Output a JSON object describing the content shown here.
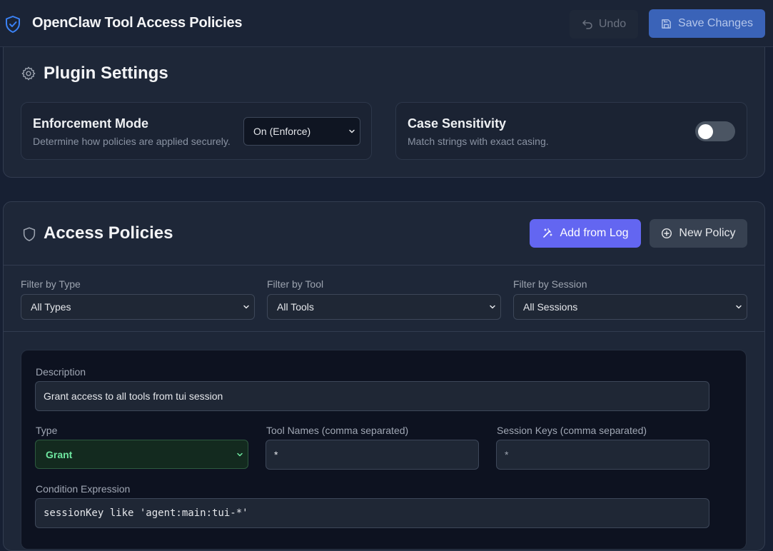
{
  "header": {
    "title": "OpenClaw Tool Access Policies",
    "undo_label": "Undo",
    "save_label": "Save Changes",
    "logo_icon": "shield-check-icon"
  },
  "plugin_settings": {
    "title": "Plugin Settings",
    "enforcement": {
      "label": "Enforcement Mode",
      "description": "Determine how policies are applied securely.",
      "value": "On (Enforce)"
    },
    "case_sensitivity": {
      "label": "Case Sensitivity",
      "description": "Match strings with exact casing.",
      "enabled": false
    }
  },
  "access_policies": {
    "title": "Access Policies",
    "add_from_log_label": "Add from Log",
    "new_policy_label": "New Policy",
    "filters": {
      "type": {
        "label": "Filter by Type",
        "value": "All Types"
      },
      "tool": {
        "label": "Filter by Tool",
        "value": "All Tools"
      },
      "session": {
        "label": "Filter by Session",
        "value": "All Sessions"
      }
    },
    "policy": {
      "description_label": "Description",
      "description_value": "Grant access to all tools from tui session",
      "type_label": "Type",
      "type_value": "Grant",
      "tool_names_label": "Tool Names (comma separated)",
      "tool_names_value": "*",
      "session_keys_label": "Session Keys (comma separated)",
      "session_keys_value": "*",
      "condition_label": "Condition Expression",
      "condition_value": "sessionKey like 'agent:main:tui-*'"
    }
  },
  "colors": {
    "background": "#172033",
    "accent": "#6366f1",
    "save": "#3a63b8",
    "grant": "#6ee7a0"
  }
}
